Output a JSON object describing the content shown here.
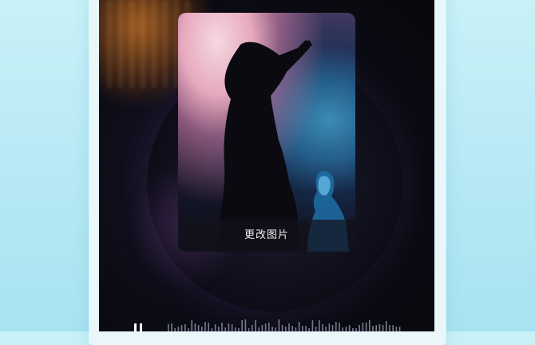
{
  "card": {
    "change_image_label": "更改图片"
  },
  "player": {
    "state": "playing"
  },
  "icons": {
    "pause": "pause-icon",
    "waveform": "waveform-icon"
  },
  "colors": {
    "background_top": "#c9f1f8",
    "background_bottom": "#a9e2f1",
    "screen": "#0c0c16",
    "card_button_text": "#f2f2f2"
  }
}
